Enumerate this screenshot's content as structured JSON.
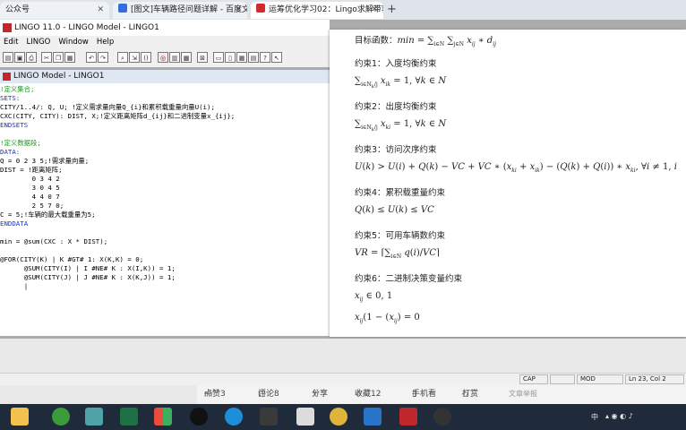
{
  "browser": {
    "tabs": [
      {
        "label": "公众号"
      },
      {
        "label": "[图文]车辆路径问题详解 - 百度文"
      },
      {
        "label": "运筹优化学习02：Lingo求解带容"
      }
    ],
    "new_tab": "+"
  },
  "lingo": {
    "window_title": "LINGO 11.0 - LINGO Model - LINGO1",
    "menu": [
      "Edit",
      "LINGO",
      "Window",
      "Help"
    ],
    "doc_title": "LINGO Model - LINGO1",
    "code_lines": [
      "!定义集合;",
      "SETS:",
      "CITY/1..4/: Q, U; !定义需求量向量Q_{i}和累积载重量向量U(i);",
      "CXC(CITY, CITY): DIST, X;!定义距离矩阵d_{ij}和二进制变量x_{ij};",
      "ENDSETS",
      "",
      "!定义数据段;",
      "DATA:",
      "Q = 0 2 3 5;!需求量向量;",
      "DIST = !距离矩阵;",
      "        0 3 4 2",
      "        3 0 4 5",
      "        4 4 0 7",
      "        2 5 7 0;",
      "C = 5;!车辆的最大载重量为5;",
      "ENDDATA",
      "",
      "min = @sum(CXC : X * DIST);",
      "",
      "@FOR(CITY(K) | K #GT# 1: X(K,K) = 0;",
      "      @SUM(CITY(I) | I #NE# K : X(I,K)) = 1;",
      "      @SUM(CITY(J) | J #NE# K : X(K,J)) = 1;",
      "      |"
    ]
  },
  "sheet": {
    "objective_label": "目标函数：",
    "c1": "约束1：入度均衡约束",
    "c2": "约束2：出度均衡约束",
    "c3": "约束3：访问次序约束",
    "c4": "约束4：累积载重量约束",
    "c5": "约束5：可用车辆数约束",
    "c6": "约束6：二进制决策变量约束"
  },
  "status": {
    "cap": "CAP",
    "mod": "MOD",
    "pos": "Ln 23, Col 2"
  },
  "interact": {
    "like": "点赞3",
    "comment": "评论8",
    "share": "分享",
    "collect": "收藏12",
    "phone": "手机看",
    "reward": "打赏",
    "report": "文章举报"
  },
  "tray": {
    "lang": "中"
  },
  "colors": {
    "comment": "#1a9a1a",
    "keyword": "#1a33cc",
    "taskbar": "#1f2a3a"
  }
}
